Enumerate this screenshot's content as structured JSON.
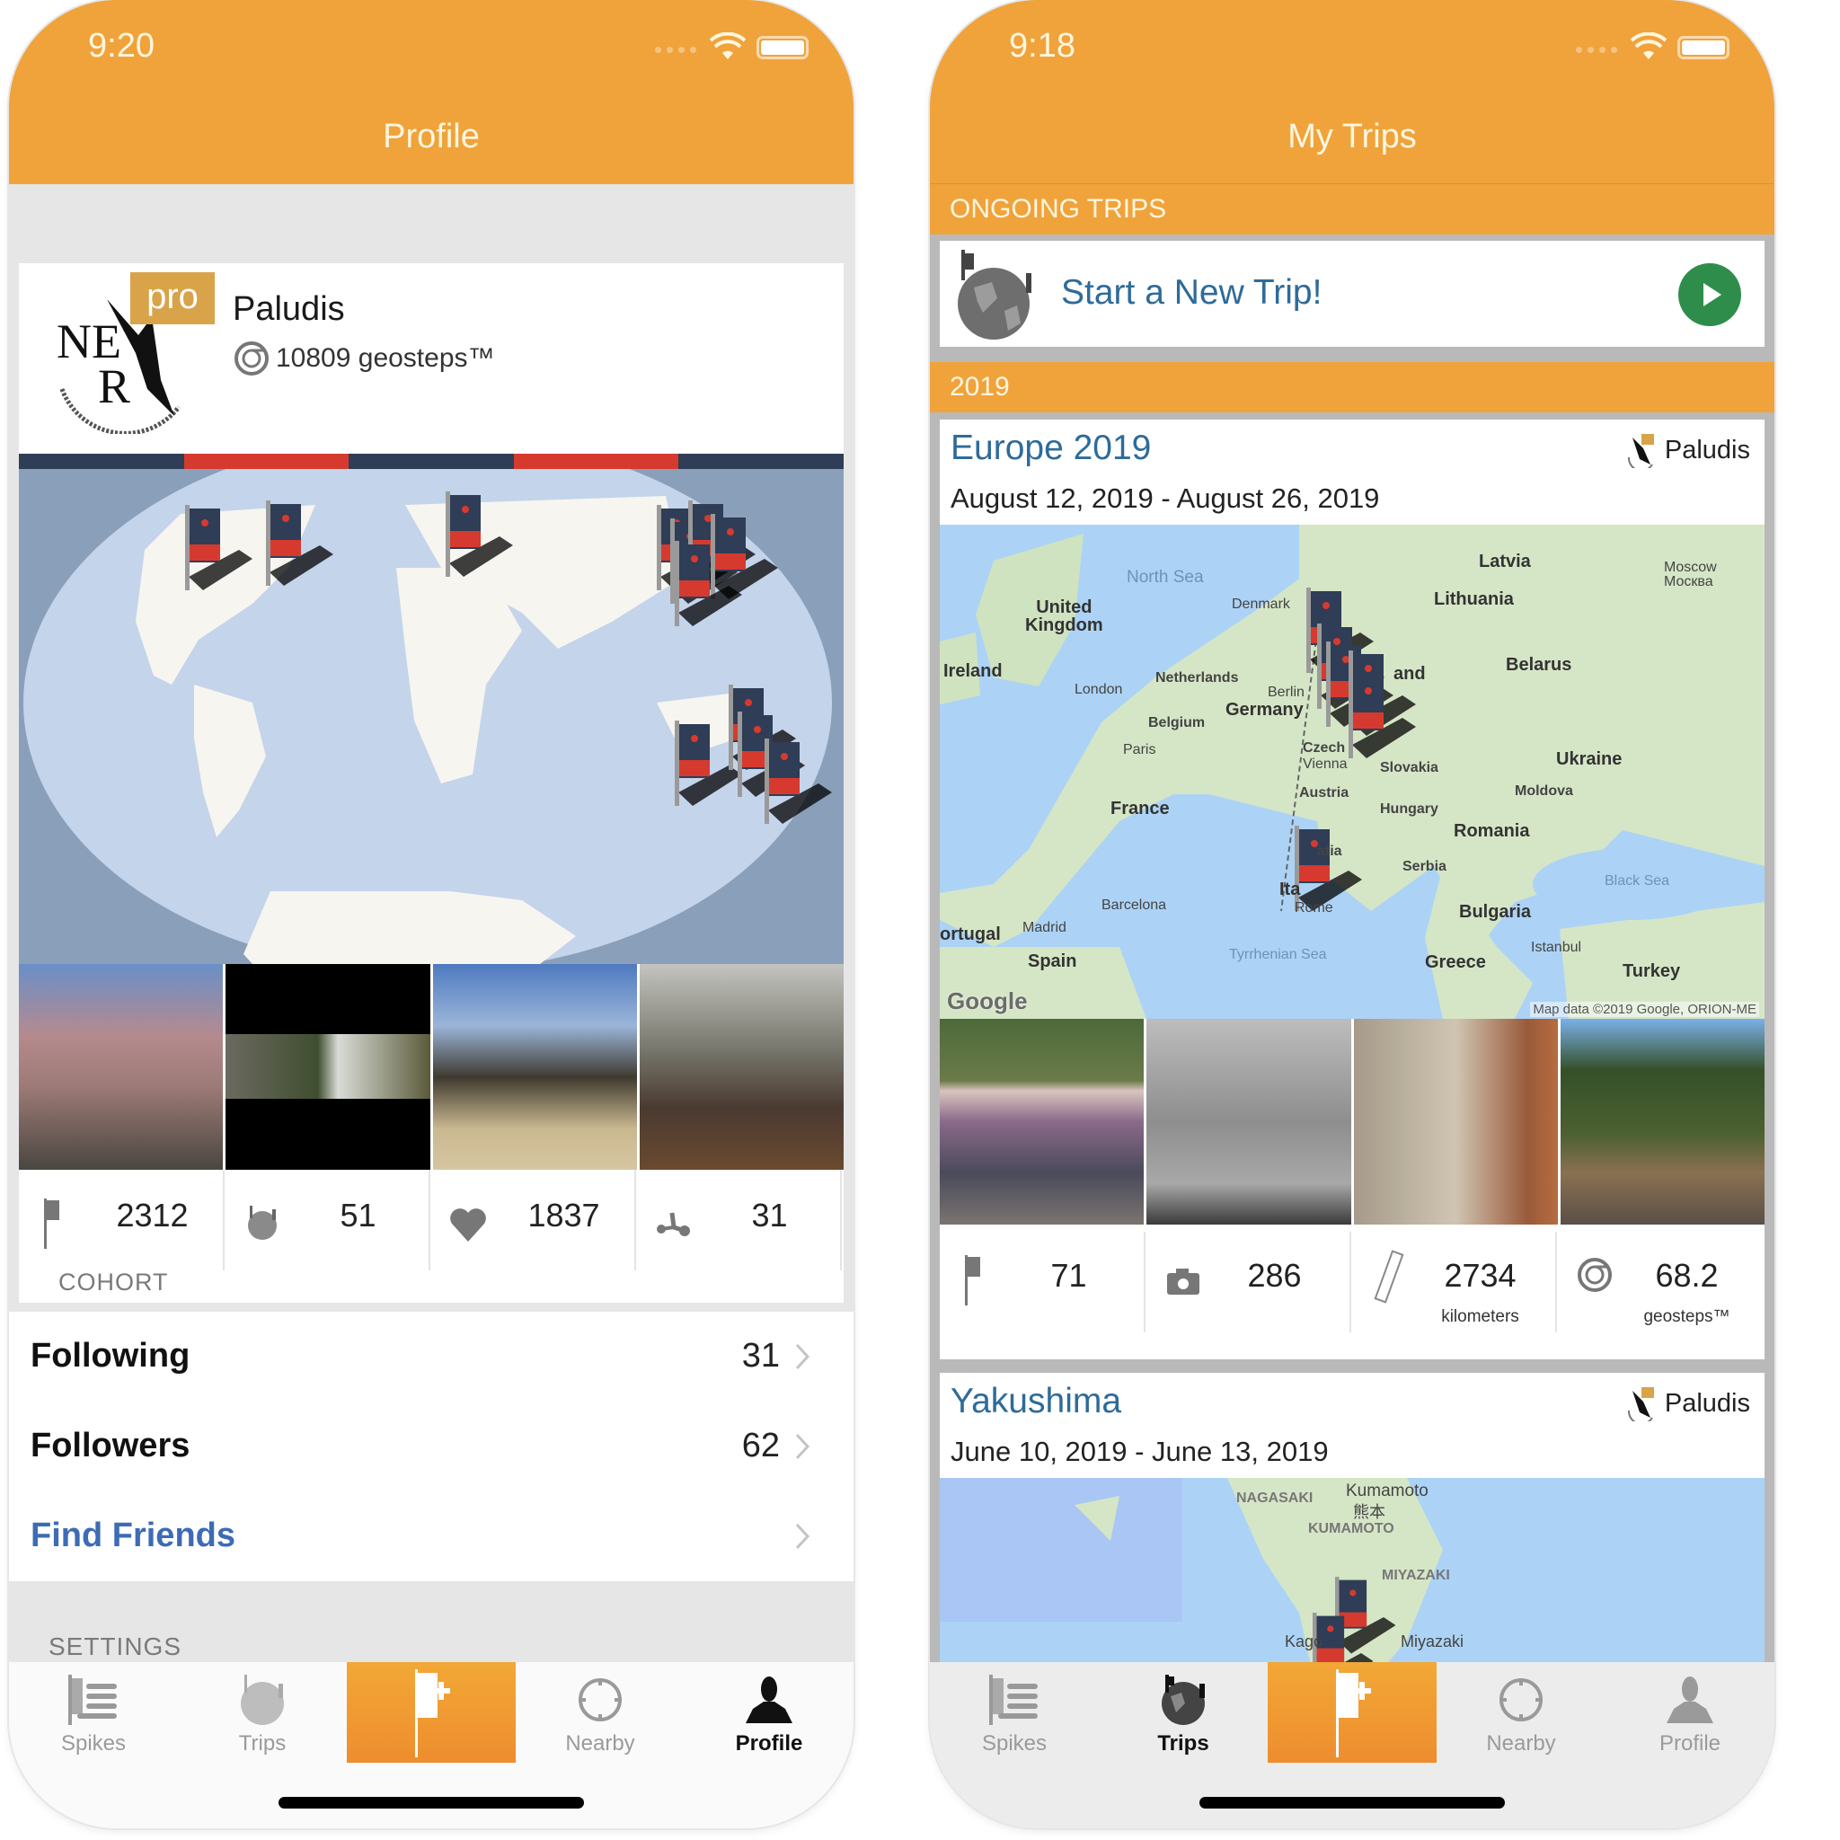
{
  "left_phone": {
    "status_bar": {
      "time": "9:20"
    },
    "nav_title": "Profile",
    "profile": {
      "badge": "pro",
      "username": "Paludis",
      "geosteps": "10809 geosteps™"
    },
    "stripe_colors": [
      "#2f3d57",
      "#d63a2f",
      "#2f3d57",
      "#d63a2f",
      "#2f3d57"
    ],
    "stats": [
      {
        "icon": "flag-icon",
        "value": "2312"
      },
      {
        "icon": "globe-trips-icon",
        "value": "51"
      },
      {
        "icon": "heart-icon",
        "value": "1837"
      },
      {
        "icon": "scooter-icon",
        "value": "31"
      }
    ],
    "cohort_label": "COHORT",
    "list": [
      {
        "label": "Following",
        "value": "31"
      },
      {
        "label": "Followers",
        "value": "62"
      },
      {
        "label": "Find Friends",
        "value": ""
      }
    ],
    "settings_label": "SETTINGS",
    "tabs": [
      {
        "label": "Spikes",
        "active": false
      },
      {
        "label": "Trips",
        "active": false
      },
      {
        "label": "",
        "active": false
      },
      {
        "label": "Nearby",
        "active": false
      },
      {
        "label": "Profile",
        "active": true
      }
    ]
  },
  "right_phone": {
    "status_bar": {
      "time": "9:18"
    },
    "nav_title": "My Trips",
    "sections": {
      "ongoing": "ONGOING TRIPS",
      "year": "2019"
    },
    "new_trip_label": "Start a New Trip!",
    "trips": [
      {
        "title": "Europe 2019",
        "owner": "Paludis",
        "dates": "August 12, 2019 - August 26, 2019",
        "map_labels": {
          "north_sea": "North Sea",
          "denmark": "Denmark",
          "latvia": "Latvia",
          "moscow": "Moscow\nМосква",
          "uk": "United\nKingdom",
          "lithuania": "Lithuania",
          "ireland": "Ireland",
          "netherlands": "Netherlands",
          "poland": "and",
          "belarus": "Belarus",
          "london": "London",
          "berlin": "Berlin",
          "germany": "Germany",
          "belgium": "Belgium",
          "czechia": "Czech",
          "paris": "Paris",
          "vienna": "Vienna",
          "slovakia": "Slovakia",
          "ukraine": "Ukraine",
          "austria": "Austria",
          "moldova": "Moldova",
          "hungary": "Hungary",
          "france": "France",
          "romania": "Romania",
          "croatia": "atia",
          "serbia": "Serbia",
          "black_sea": "Black Sea",
          "italy": "Ita",
          "barcelona": "Barcelona",
          "rome": "Rome",
          "bulgaria": "Bulgaria",
          "portugal": "ortugal",
          "madrid": "Madrid",
          "istanbul": "Istanbul",
          "tyrrhenian": "Tyrrhenian Sea",
          "spain": "Spain",
          "greece": "Greece",
          "turkey": "Turkey"
        },
        "map_attribution": "Map data ©2019 Google, ORION-ME",
        "google_logo": "Google",
        "stats": [
          {
            "icon": "flag-icon",
            "value": "71",
            "unit": ""
          },
          {
            "icon": "camera-icon",
            "value": "286",
            "unit": ""
          },
          {
            "icon": "ruler-icon",
            "value": "2734",
            "unit": "kilometers"
          },
          {
            "icon": "geosteps-icon",
            "value": "68.2",
            "unit": "geosteps™"
          }
        ]
      },
      {
        "title": "Yakushima",
        "owner": "Paludis",
        "dates": "June 10, 2019 - June 13, 2019",
        "map_labels": {
          "nagasaki": "NAGASAKI",
          "kumamoto_city": "Kumamoto",
          "kumamoto_kanji": "熊本",
          "kumamoto_pref": "KUMAMOTO",
          "miyazaki_pref": "MIYAZAKI",
          "kagoshima": "Kago",
          "miyazaki_city": "Miyazaki"
        }
      }
    ],
    "tabs": [
      {
        "label": "Spikes",
        "active": false
      },
      {
        "label": "Trips",
        "active": true
      },
      {
        "label": "",
        "active": false
      },
      {
        "label": "Nearby",
        "active": false
      },
      {
        "label": "Profile",
        "active": false
      }
    ]
  },
  "colors": {
    "brand_orange": "#f0a33b",
    "link_blue": "#3d6bb5",
    "trip_title_blue": "#2e6b99",
    "play_green": "#2f8d4c",
    "flag_navy": "#2f3d57",
    "flag_red": "#d63a2f"
  }
}
